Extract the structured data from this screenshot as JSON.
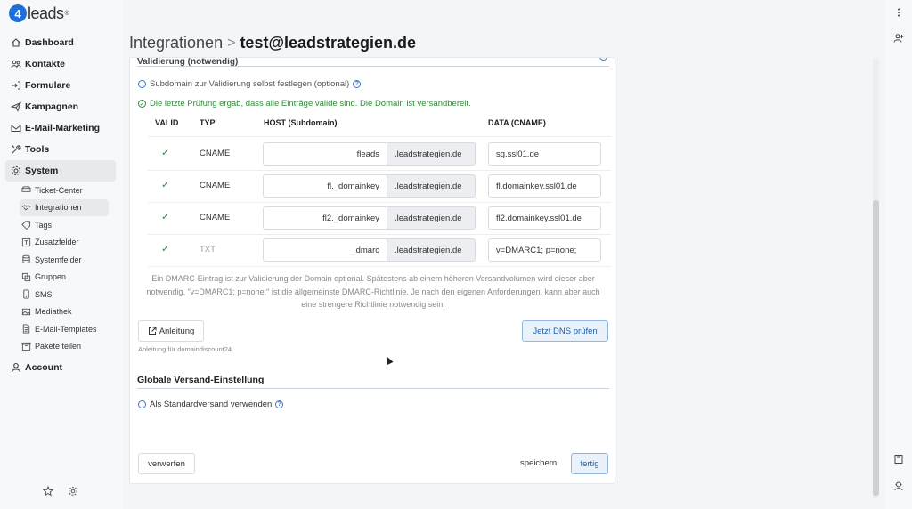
{
  "logo": {
    "mark": "4",
    "text": "leads",
    "sup": "®"
  },
  "nav": {
    "dashboard": "Dashboard",
    "kontakte": "Kontakte",
    "formulare": "Formulare",
    "kampagnen": "Kampagnen",
    "email_marketing": "E-Mail-Marketing",
    "tools": "Tools",
    "system": "System",
    "sub": [
      "Ticket-Center",
      "Integrationen",
      "Tags",
      "Zusatzfelder",
      "Systemfelder",
      "Gruppen",
      "SMS",
      "Mediathek",
      "E-Mail-Templates",
      "Pakete teilen"
    ],
    "account": "Account"
  },
  "header": {
    "crumb": "Integrationen",
    "separator": ">",
    "current": "test@leadstrategien.de"
  },
  "card": {
    "top_title": "Validierung (notwendig)",
    "subdomain_option": "Subdomain zur Validierung selbst festlegen (optional)",
    "help_glyph": "?",
    "check_message": "Die letzte Prüfung ergab, dass alle Einträge valide sind. Die Domain ist versandbereit.",
    "table": {
      "headers": [
        "VALID",
        "TYP",
        "HOST (Subdomain)",
        "DATA (CNAME)"
      ],
      "rows": [
        {
          "valid": "✓",
          "typ": "CNAME",
          "host": "fleads",
          "suffix": ".leadstrategien.de",
          "data": "sg.ssl01.de"
        },
        {
          "valid": "✓",
          "typ": "CNAME",
          "host": "fl._domainkey",
          "suffix": ".leadstrategien.de",
          "data": "fl.domainkey.ssl01.de"
        },
        {
          "valid": "✓",
          "typ": "CNAME",
          "host": "fl2._domainkey",
          "suffix": ".leadstrategien.de",
          "data": "fl2.domainkey.ssl01.de"
        },
        {
          "valid": "✓",
          "typ": "TXT",
          "host": "_dmarc",
          "suffix": ".leadstrategien.de",
          "data": "v=DMARC1; p=none;"
        }
      ]
    },
    "dmarc_note": "Ein DMARC-Eintrag ist zur Validierung der Domain optional. Spätestens ab einem höheren Versandvolumen wird dieser aber notwendig. \"v=DMARC1; p=none;\" ist die allgemeinste DMARC-Richtlinie. Je nach den eigenen Anforderungen, kann aber auch eine strengere Richtlinie notwendig sein.",
    "anleitung_button": "Anleitung",
    "anleitung_hint": "Anleitung für domaindiscount24",
    "dns_check_button": "Jetzt DNS prüfen",
    "global_section_title": "Globale Versand-Einstellung",
    "standard_option": "Als Standardversand verwenden",
    "discard_button": "verwerfen",
    "save_button": "speichern",
    "done_button": "fertig"
  },
  "colors": {
    "accent": "#1e6fd9",
    "success": "#2e8b3a",
    "primary_btn_bg": "#e9f2fb"
  }
}
